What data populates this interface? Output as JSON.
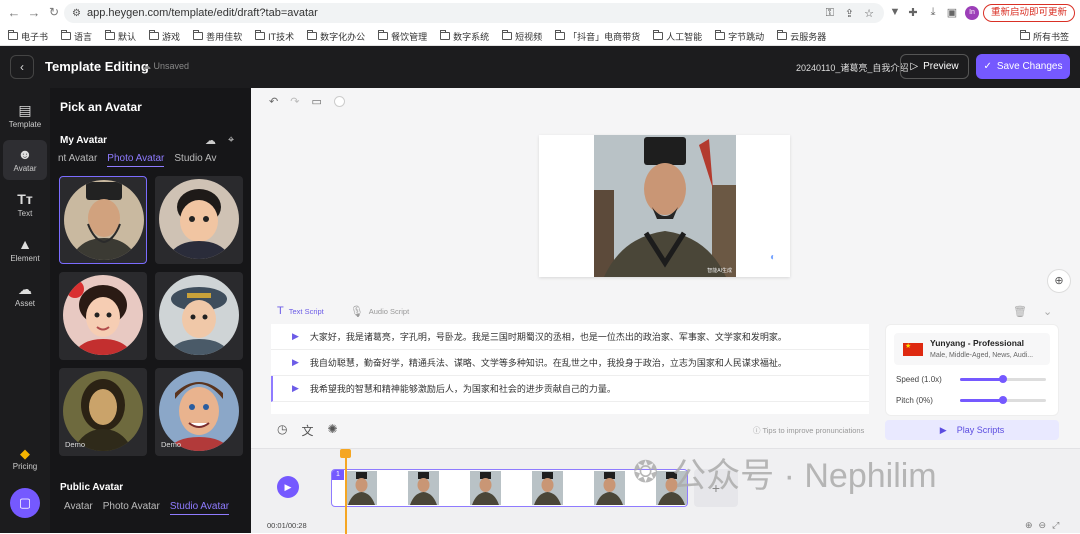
{
  "browser": {
    "url": "app.heygen.com/template/edit/draft?tab=avatar",
    "restart_label": "重新启动即可更新",
    "profile_initial": "In",
    "bookmarks": [
      "电子书",
      "语言",
      "默认",
      "游戏",
      "善用佳软",
      "IT技术",
      "数字化办公",
      "餐饮管理",
      "数字系统",
      "短视频",
      "「抖音」电商带货",
      "人工智能",
      "字节跳动",
      "云服务器"
    ],
    "all_bookmarks": "所有书签"
  },
  "topbar": {
    "title": "Template Editing",
    "status": "Unsaved",
    "draft_name": "20240110_诸葛亮_自我介绍",
    "preview_label": "Preview",
    "save_label": "Save Changes"
  },
  "sidebar": {
    "items": [
      {
        "label": "Template",
        "icon": "template-icon"
      },
      {
        "label": "Avatar",
        "icon": "avatar-icon",
        "active": true
      },
      {
        "label": "Text",
        "icon": "text-icon"
      },
      {
        "label": "Element",
        "icon": "element-icon"
      },
      {
        "label": "Asset",
        "icon": "asset-icon"
      }
    ],
    "pricing_label": "Pricing"
  },
  "avatar_panel": {
    "title": "Pick an Avatar",
    "my_avatar_title": "My Avatar",
    "my_tabs": [
      "nt Avatar",
      "Photo Avatar",
      "Studio Av"
    ],
    "my_active_tab": 1,
    "demo_label": "Demo",
    "public_avatar_title": "Public Avatar",
    "public_tabs": [
      "Avatar",
      "Photo Avatar",
      "Studio Avatar"
    ],
    "public_active_tab": 2
  },
  "canvas": {
    "stamp": "智能AI生成"
  },
  "script": {
    "tabs": [
      "Text Script",
      "Audio Script"
    ],
    "lines": [
      "大家好，我是诸葛亮，字孔明，号卧龙。我是三国时期蜀汉的丞相，也是一位杰出的政治家、军事家、文学家和发明家。",
      "我自幼聪慧，勤奋好学，精通兵法、谋略、文学等多种知识。在乱世之中，我投身于政治，立志为国家和人民谋求福祉。",
      "我希望我的智慧和精神能够激励后人，为国家和社会的进步贡献自己的力量。"
    ],
    "tips_label": "Tips to improve pronunciations",
    "play_label": "Play Scripts"
  },
  "voice": {
    "name": "Yunyang - Professional",
    "description": "Male, Middle-Aged, News, Audi...",
    "speed_label": "Speed (1.0x)",
    "speed_level": 0.5,
    "pitch_label": "Pitch (0%)",
    "pitch_level": 0.5
  },
  "timeline": {
    "clip_number": "1",
    "time": "00:01/00:28",
    "playhead_fraction": 0.04
  },
  "watermark": {
    "text": "公众号 · Nephilim"
  }
}
